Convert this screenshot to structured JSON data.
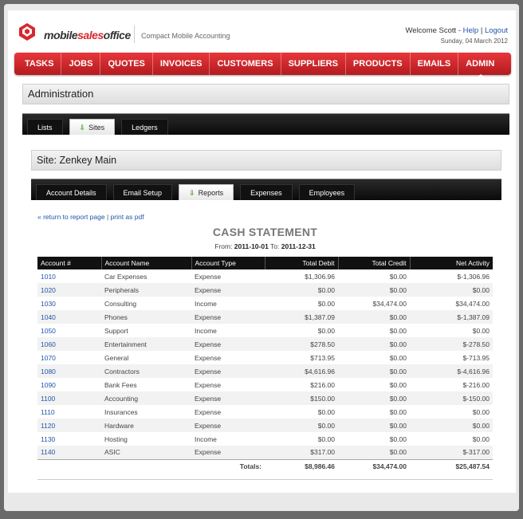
{
  "header": {
    "brand_part1": "mobile",
    "brand_part2": "sales",
    "brand_part3": "office",
    "tagline": "Compact Mobile Accounting",
    "welcome": "Welcome Scott - ",
    "help": "Help",
    "logout": "Logout",
    "separator": "|",
    "date": "Sunday, 04 March 2012"
  },
  "nav": [
    "TASKS",
    "JOBS",
    "QUOTES",
    "INVOICES",
    "CUSTOMERS",
    "SUPPLIERS",
    "PRODUCTS",
    "EMAILS",
    "ADMIN"
  ],
  "admin": {
    "title": "Administration",
    "tabs": [
      "Lists",
      "Sites",
      "Ledgers"
    ],
    "active_tab": "Sites"
  },
  "site": {
    "title": "Site: Zenkey Main",
    "tabs": [
      "Account Details",
      "Email Setup",
      "Reports",
      "Expenses",
      "Employees"
    ],
    "active_tab": "Reports"
  },
  "report": {
    "return_link": "« return to report page",
    "sep": " | ",
    "print_link": "print as pdf",
    "title": "CASH STATEMENT",
    "from_label": "From: ",
    "from_date": "2011-10-01",
    "to_label": " To: ",
    "to_date": "2011-12-31",
    "columns": [
      "Account #",
      "Account Name",
      "Account Type",
      "Total Debit",
      "Total Credit",
      "Net Activity"
    ],
    "rows": [
      [
        "1010",
        "Car Expenses",
        "Expense",
        "$1,306.96",
        "$0.00",
        "$-1,306.96"
      ],
      [
        "1020",
        "Peripherals",
        "Expense",
        "$0.00",
        "$0.00",
        "$0.00"
      ],
      [
        "1030",
        "Consulting",
        "Income",
        "$0.00",
        "$34,474.00",
        "$34,474.00"
      ],
      [
        "1040",
        "Phones",
        "Expense",
        "$1,387.09",
        "$0.00",
        "$-1,387.09"
      ],
      [
        "1050",
        "Support",
        "Income",
        "$0.00",
        "$0.00",
        "$0.00"
      ],
      [
        "1060",
        "Entertainment",
        "Expense",
        "$278.50",
        "$0.00",
        "$-278.50"
      ],
      [
        "1070",
        "General",
        "Expense",
        "$713.95",
        "$0.00",
        "$-713.95"
      ],
      [
        "1080",
        "Contractors",
        "Expense",
        "$4,616.96",
        "$0.00",
        "$-4,616.96"
      ],
      [
        "1090",
        "Bank Fees",
        "Expense",
        "$216.00",
        "$0.00",
        "$-216.00"
      ],
      [
        "1100",
        "Accounting",
        "Expense",
        "$150.00",
        "$0.00",
        "$-150.00"
      ],
      [
        "1110",
        "Insurances",
        "Expense",
        "$0.00",
        "$0.00",
        "$0.00"
      ],
      [
        "1120",
        "Hardware",
        "Expense",
        "$0.00",
        "$0.00",
        "$0.00"
      ],
      [
        "1130",
        "Hosting",
        "Income",
        "$0.00",
        "$0.00",
        "$0.00"
      ],
      [
        "1140",
        "ASIC",
        "Expense",
        "$317.00",
        "$0.00",
        "$-317.00"
      ]
    ],
    "totals": {
      "label": "Totals:",
      "debit": "$8,986.46",
      "credit": "$34,474.00",
      "net": "$25,487.54"
    }
  },
  "colors": {
    "brand_red": "#d9272e",
    "link_blue": "#2255aa",
    "active_arrow": "#3c9a1e"
  }
}
